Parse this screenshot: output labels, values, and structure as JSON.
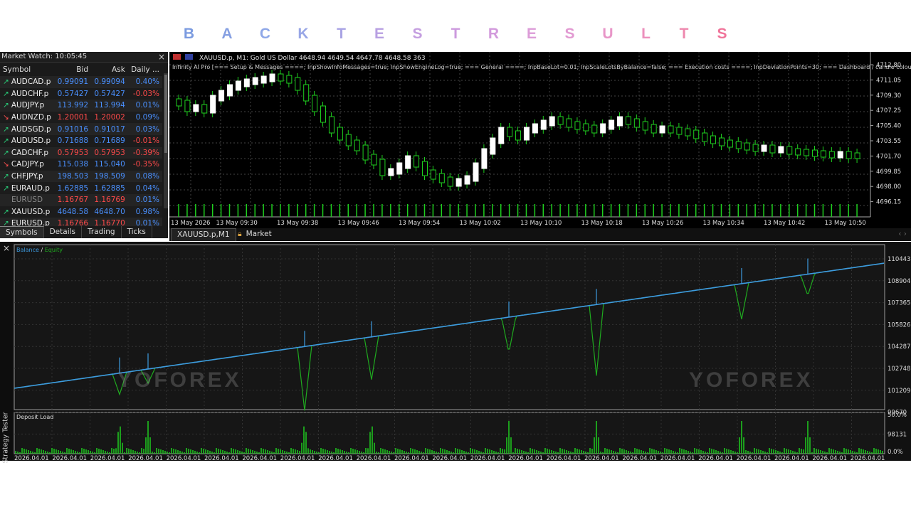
{
  "banner": {
    "letters": [
      "B",
      "A",
      "C",
      "K",
      "T",
      "E",
      "S",
      "T",
      "R",
      "E",
      "S",
      "U",
      "L",
      "T",
      "S"
    ],
    "colors": [
      "#7b9be0",
      "#86a0e2",
      "#8fa8e8",
      "#98a6e6",
      "#a9a3e4",
      "#b8a0e2",
      "#c49ee0",
      "#cc9ade",
      "#d29adc",
      "#dc9cd8",
      "#e29ad2",
      "#e896c8",
      "#ec90bc",
      "#ee88ae",
      "#f0749a"
    ]
  },
  "market_watch": {
    "title": "Market Watch: 10:05:45",
    "close": "×",
    "headers": {
      "symbol": "Symbol",
      "bid": "Bid",
      "ask": "Ask",
      "daily": "Daily ..."
    },
    "rows": [
      {
        "dir": "up",
        "symbol": "AUDCAD.p",
        "bid": "0.99091",
        "ask": "0.99094",
        "daily": "0.40%",
        "color": "blue"
      },
      {
        "dir": "up",
        "symbol": "AUDCHF.p",
        "bid": "0.57427",
        "ask": "0.57427",
        "daily": "-0.03%",
        "color": "blue"
      },
      {
        "dir": "up",
        "symbol": "AUDJPY.p",
        "bid": "113.992",
        "ask": "113.994",
        "daily": "0.01%",
        "color": "blue"
      },
      {
        "dir": "down",
        "symbol": "AUDNZD.p",
        "bid": "1.20001",
        "ask": "1.20002",
        "daily": "0.09%",
        "color": "red"
      },
      {
        "dir": "up",
        "symbol": "AUDSGD.p",
        "bid": "0.91016",
        "ask": "0.91017",
        "daily": "0.03%",
        "color": "blue"
      },
      {
        "dir": "up",
        "symbol": "AUDUSD.p",
        "bid": "0.71688",
        "ask": "0.71689",
        "daily": "-0.01%",
        "color": "blue"
      },
      {
        "dir": "up",
        "symbol": "CADCHF.p",
        "bid": "0.57953",
        "ask": "0.57953",
        "daily": "-0.39%",
        "color": "red"
      },
      {
        "dir": "down",
        "symbol": "CADJPY.p",
        "bid": "115.038",
        "ask": "115.040",
        "daily": "-0.35%",
        "color": "blue"
      },
      {
        "dir": "up",
        "symbol": "CHFJPY.p",
        "bid": "198.503",
        "ask": "198.509",
        "daily": "0.08%",
        "color": "blue"
      },
      {
        "dir": "up",
        "symbol": "EURAUD.p",
        "bid": "1.62885",
        "ask": "1.62885",
        "daily": "0.04%",
        "color": "blue"
      },
      {
        "dir": "none",
        "symbol": "EURUSD",
        "bid": "1.16767",
        "ask": "1.16769",
        "daily": "0.01%",
        "color": "red"
      },
      {
        "dir": "up",
        "symbol": "XAUUSD.p",
        "bid": "4648.58",
        "ask": "4648.70",
        "daily": "0.98%",
        "color": "blue"
      },
      {
        "dir": "up",
        "symbol": "EURUSD.p",
        "bid": "1.16766",
        "ask": "1.16770",
        "daily": "0.01%",
        "color": "red"
      }
    ],
    "tabs": [
      "Symbols",
      "Details",
      "Trading",
      "Ticks"
    ]
  },
  "chart": {
    "header": "XAUUSD.p, M1:  Gold US Dollar  4648.94 4649.54 4647.78 4648.58  363",
    "ea_line": "Infinity AI Pro [=== Setup & Messages ====; InpShowInfoMessages=true; InpShowEngineLog=true; === General ====; InpBaseLot=0.01; InpScaleLotsByBalance=false; === Execution costs ====; InpDeviationPoints=30; === Dashboard / candle colours ====; In",
    "price_labels": [
      "4712.80",
      "4711.05",
      "4709.30",
      "4707.25",
      "4705.40",
      "4703.55",
      "4701.70",
      "4699.85",
      "4698.00",
      "4696.15"
    ],
    "time_labels": [
      "13 May 2026",
      "13 May 09:30",
      "13 May 09:38",
      "13 May 09:46",
      "13 May 09:54",
      "13 May 10:02",
      "13 May 10:10",
      "13 May 10:18",
      "13 May 10:26",
      "13 May 10:34",
      "13 May 10:42",
      "13 May 10:50"
    ],
    "tab_active": "XAUUSD.p,M1",
    "tab_market": "Market",
    "nav": "‹  ›"
  },
  "tester": {
    "close": "×",
    "side_label": "Strategy Tester",
    "legend_balance": "Balance",
    "legend_sep": " / ",
    "legend_equity": "Equity",
    "balance_color": "#3d9be0",
    "equity_color": "#1faa1f",
    "y_labels": [
      "110443",
      "108904",
      "107365",
      "105826",
      "104287",
      "102748",
      "101209",
      "99670",
      "98131"
    ],
    "deposit_label": "Deposit Load",
    "deposit_y": [
      "50.0%",
      "0.0%"
    ],
    "date_label": "2026.04.01",
    "date_count": 23,
    "watermark": "YOFOREX"
  }
}
